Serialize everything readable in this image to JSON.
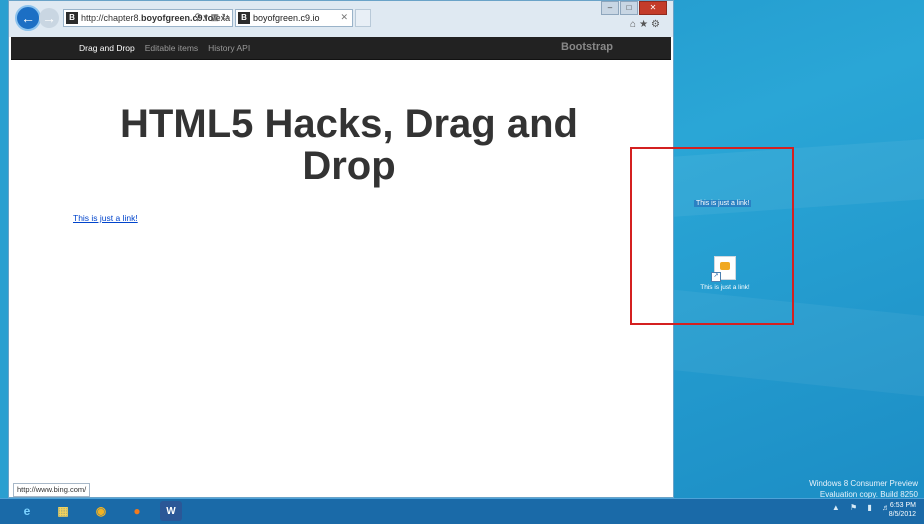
{
  "browser": {
    "address_prefix": "http://chapter8.",
    "address_domain": "boyofgreen.c9.io",
    "address_suffix": "/exa",
    "tab_title": "boyofgreen.c9.io",
    "favicon_letter": "B"
  },
  "navbar": {
    "links": [
      "Drag and Drop",
      "Editable items",
      "History API"
    ],
    "brand": "Bootstrap"
  },
  "page": {
    "title": "HTML5 Hacks, Drag and Drop",
    "link_text": "This is just a link!"
  },
  "status_bar": {
    "url": "http://www.bing.com/"
  },
  "desktop": {
    "dragged_text": "This is just a link!",
    "file_label": "This is just a link!"
  },
  "watermark": {
    "line1": "Windows 8 Consumer Preview",
    "line2": "Evaluation copy. Build 8250"
  },
  "clock": {
    "time": "6:53 PM",
    "date": "8/5/2012"
  },
  "colors": {
    "dropzone_border": "#d42020",
    "navbar": "#222222",
    "taskbar": "#1a6aa8"
  }
}
